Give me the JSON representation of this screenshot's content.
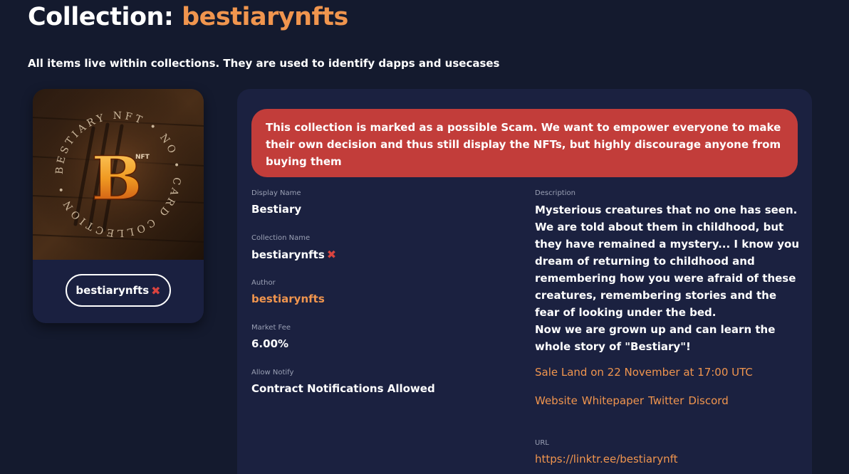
{
  "header": {
    "title_prefix": "Collection:",
    "title_collection": "bestiarynfts",
    "subtitle": "All items live within collections. They are used to identify dapps and usecases"
  },
  "image_card": {
    "chip_label": "bestiarynfts",
    "chip_icon": "x-icon",
    "image_ring_text": "BESTIARY NFT • NO • CARD COLLECTION •",
    "image_logo_letter": "B",
    "image_logo_tag": "NFT"
  },
  "warning": {
    "text": "This collection is marked as a possible Scam. We want to empower everyone to make their own decision and thus still display the NFTs, but highly discourage anyone from buying them"
  },
  "fields": {
    "display_name": {
      "label": "Display Name",
      "value": "Bestiary"
    },
    "collection_name": {
      "label": "Collection Name",
      "value": "bestiarynfts"
    },
    "author": {
      "label": "Author",
      "value": "bestiarynfts"
    },
    "market_fee": {
      "label": "Market Fee",
      "value": "6.00%"
    },
    "allow_notify": {
      "label": "Allow Notify",
      "value": "Contract Notifications Allowed"
    },
    "description": {
      "label": "Description",
      "lines": [
        "Mysterious creatures that no one has seen.",
        "We are told about them in childhood, but",
        "they have remained a mystery... I know you",
        "dream of returning to childhood and",
        "remembering how you were afraid of these",
        "creatures, remembering stories and the",
        "fear of looking under the bed.",
        "Now we are grown up and can learn the",
        "whole story of \"Bestiary\"!"
      ],
      "sale_text": "Sale Land on 22 November at 17:00 UTC",
      "links": [
        "Website",
        "Whitepaper",
        "Twitter",
        "Discord"
      ]
    },
    "url": {
      "label": "URL",
      "value": "https://linktr.ee/bestiarynft"
    }
  },
  "colors": {
    "background": "#141a2e",
    "panel": "#1b2140",
    "accent": "#f0954e",
    "danger": "#c23d3a"
  }
}
